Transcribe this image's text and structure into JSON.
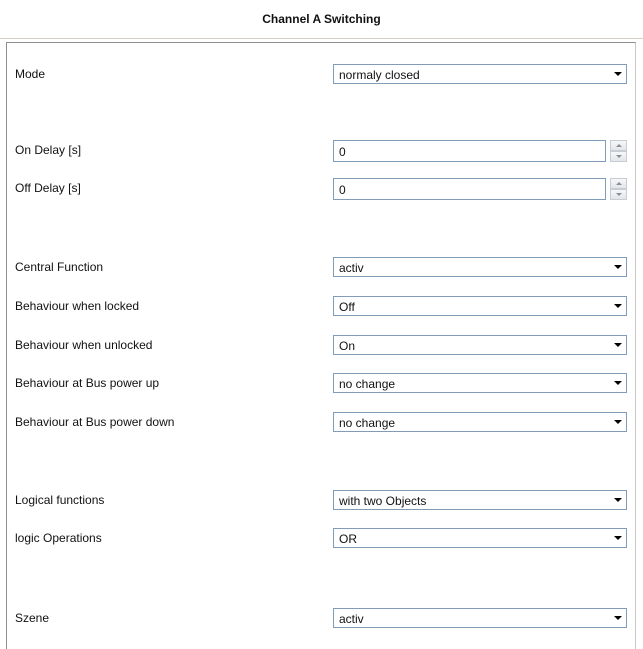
{
  "title": "Channel A Switching",
  "rows": {
    "mode": {
      "label": "Mode",
      "value": "normaly closed"
    },
    "on_delay": {
      "label": "On Delay [s]",
      "value": "0"
    },
    "off_delay": {
      "label": "Off Delay [s]",
      "value": "0"
    },
    "central_function": {
      "label": "Central Function",
      "value": "activ"
    },
    "when_locked": {
      "label": "Behaviour when locked",
      "value": "Off"
    },
    "when_unlocked": {
      "label": "Behaviour when unlocked",
      "value": "On"
    },
    "bus_power_up": {
      "label": "Behaviour at Bus power up",
      "value": "no change"
    },
    "bus_power_down": {
      "label": "Behaviour at Bus power down",
      "value": "no change"
    },
    "logical_functions": {
      "label": "Logical functions",
      "value": "with two Objects"
    },
    "logic_operations": {
      "label": "logic Operations",
      "value": "OR"
    },
    "szene": {
      "label": "Szene",
      "value": "activ"
    }
  },
  "icons": {
    "dropdown": "chevron-down-icon",
    "spin_up": "spin-up-icon",
    "spin_down": "spin-down-icon"
  }
}
